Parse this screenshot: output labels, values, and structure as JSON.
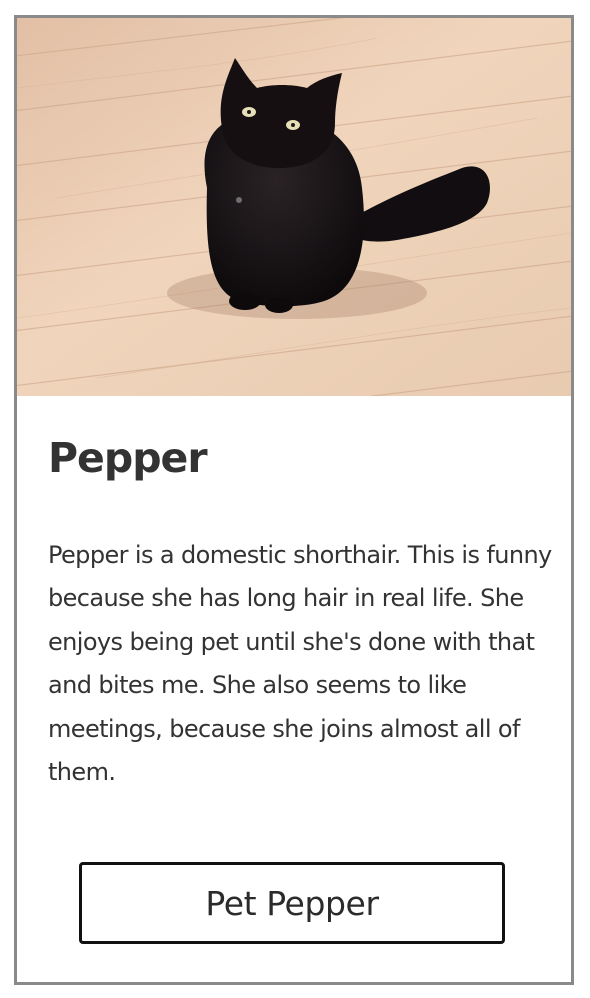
{
  "card": {
    "image": {
      "alt": "Pepper",
      "subject": "cat-photo"
    },
    "title": "Pepper",
    "description": "Pepper is a domestic shorthair. This is funny because she has long hair in real life. She enjoys being pet until she's done with that and bites me. She also seems to like meetings, because she joins almost all of them.",
    "button_label": "Pet Pepper"
  },
  "colors": {
    "border": "#8a8a8a",
    "text": "#333333",
    "button_border": "#111111"
  }
}
